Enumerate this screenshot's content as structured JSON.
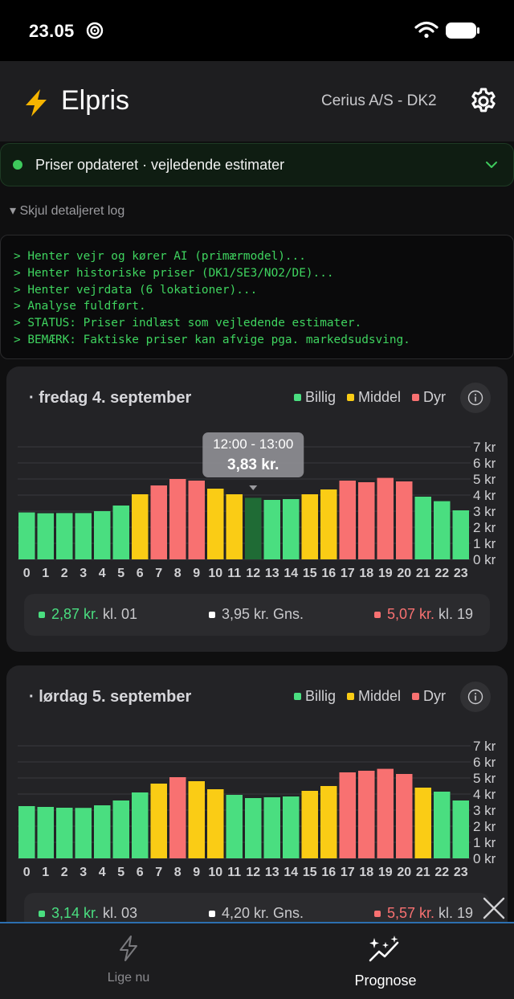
{
  "status_bar": {
    "time": "23.05"
  },
  "header": {
    "title": "Elpris",
    "provider": "Cerius A/S - DK2"
  },
  "status_banner": {
    "text": "Priser opdateret · vejledende estimater"
  },
  "log": {
    "toggle_label": "▾ Skjul detaljeret log",
    "lines": [
      "> Henter vejr og kører AI (primærmodel)...",
      "> Henter historiske priser (DK1/SE3/NO2/DE)...",
      "> Henter vejrdata (6 lokationer)...",
      "> Analyse fuldført.",
      "> STATUS: Priser indlæst som vejledende estimater.",
      "> BEMÆRK: Faktiske priser kan afvige pga. markedsudsving."
    ]
  },
  "legend": {
    "cheap": "Billig",
    "mid": "Middel",
    "expensive": "Dyr"
  },
  "colors": {
    "cheap": "#4ade80",
    "mid": "#facc15",
    "expensive": "#f87171",
    "selected": "#1f6b35"
  },
  "days": [
    {
      "title": "· fredag 4. september",
      "tooltip": {
        "time": "12:00 - 13:00",
        "price": "3,83 kr."
      },
      "summary": {
        "min_value": "2,87 kr.",
        "min_label": "kl. 01",
        "avg_value": "3,95 kr.",
        "avg_label": "Gns.",
        "max_value": "5,07 kr.",
        "max_label": "kl. 19"
      }
    },
    {
      "title": "· lørdag 5. september",
      "summary": {
        "min_value": "3,14 kr.",
        "min_label": "kl. 03",
        "avg_value": "4,20 kr.",
        "avg_label": "Gns.",
        "max_value": "5,57 kr.",
        "max_label": "kl. 19"
      }
    }
  ],
  "chart_data": [
    {
      "type": "bar",
      "categories": [
        "0",
        "1",
        "2",
        "3",
        "4",
        "5",
        "6",
        "7",
        "8",
        "9",
        "10",
        "11",
        "12",
        "13",
        "14",
        "15",
        "16",
        "17",
        "18",
        "19",
        "20",
        "21",
        "22",
        "23"
      ],
      "values": [
        2.92,
        2.87,
        2.88,
        2.88,
        3.0,
        3.35,
        4.05,
        4.6,
        5.0,
        4.9,
        4.4,
        4.05,
        3.83,
        3.7,
        3.75,
        4.05,
        4.35,
        4.9,
        4.8,
        5.07,
        4.85,
        3.9,
        3.62,
        3.05
      ],
      "levels": [
        "cheap",
        "cheap",
        "cheap",
        "cheap",
        "cheap",
        "cheap",
        "mid",
        "expensive",
        "expensive",
        "expensive",
        "mid",
        "mid",
        "selected",
        "cheap",
        "cheap",
        "mid",
        "mid",
        "expensive",
        "expensive",
        "expensive",
        "expensive",
        "cheap",
        "cheap",
        "cheap"
      ],
      "ylim": [
        0,
        7
      ],
      "yticks": [
        "0 kr",
        "1 kr",
        "2 kr",
        "3 kr",
        "4 kr",
        "5 kr",
        "6 kr",
        "7 kr"
      ],
      "selected_index": 12
    },
    {
      "type": "bar",
      "categories": [
        "0",
        "1",
        "2",
        "3",
        "4",
        "5",
        "6",
        "7",
        "8",
        "9",
        "10",
        "11",
        "12",
        "13",
        "14",
        "15",
        "16",
        "17",
        "18",
        "19",
        "20",
        "21",
        "22",
        "23"
      ],
      "values": [
        3.25,
        3.2,
        3.15,
        3.14,
        3.3,
        3.6,
        4.1,
        4.65,
        5.05,
        4.8,
        4.3,
        3.95,
        3.75,
        3.8,
        3.85,
        4.2,
        4.5,
        5.35,
        5.45,
        5.57,
        5.25,
        4.4,
        4.15,
        3.6
      ],
      "levels": [
        "cheap",
        "cheap",
        "cheap",
        "cheap",
        "cheap",
        "cheap",
        "cheap",
        "mid",
        "expensive",
        "mid",
        "mid",
        "cheap",
        "cheap",
        "cheap",
        "cheap",
        "mid",
        "mid",
        "expensive",
        "expensive",
        "expensive",
        "expensive",
        "mid",
        "cheap",
        "cheap"
      ],
      "ylim": [
        0,
        7
      ],
      "yticks": [
        "0 kr",
        "1 kr",
        "2 kr",
        "3 kr",
        "4 kr",
        "5 kr",
        "6 kr",
        "7 kr"
      ]
    }
  ],
  "nav": {
    "now_label": "Lige nu",
    "forecast_label": "Prognose"
  }
}
